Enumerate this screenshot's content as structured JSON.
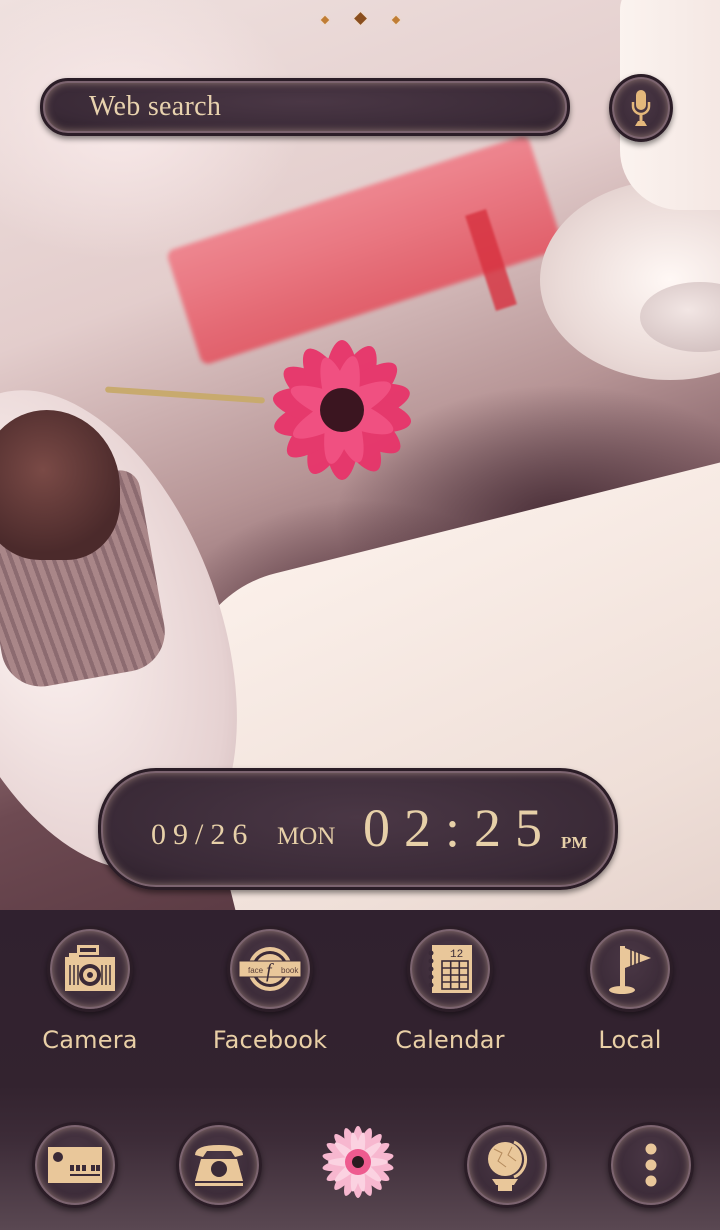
{
  "wallpaper": {
    "description": "coffee table with pink gerbera flower, chocolate muffin, red notebook, coffee cup"
  },
  "page_indicator": {
    "count": 3,
    "active_index": 1
  },
  "search": {
    "placeholder": "Web search"
  },
  "clock": {
    "date": "09/26",
    "day": "MON",
    "time": "02:25",
    "ampm": "PM"
  },
  "apps": [
    {
      "label": "Camera",
      "icon": "camera-icon"
    },
    {
      "label": "Facebook",
      "icon": "facebook-icon",
      "icon_text_left": "face",
      "icon_text_center": "f",
      "icon_text_right": "book"
    },
    {
      "label": "Calendar",
      "icon": "calendar-icon",
      "icon_text": "12"
    },
    {
      "label": "Local",
      "icon": "flag-icon"
    }
  ],
  "dock": [
    {
      "icon": "mail-icon"
    },
    {
      "icon": "phone-icon"
    },
    {
      "icon": "flower-app-drawer-icon"
    },
    {
      "icon": "globe-icon"
    },
    {
      "icon": "more-icon"
    }
  ],
  "colors": {
    "accent_gold": "#e9cfa6",
    "panel_dark": "#3a2a37",
    "dock_background": "#30212f",
    "flower_pink": "#e8346a"
  }
}
